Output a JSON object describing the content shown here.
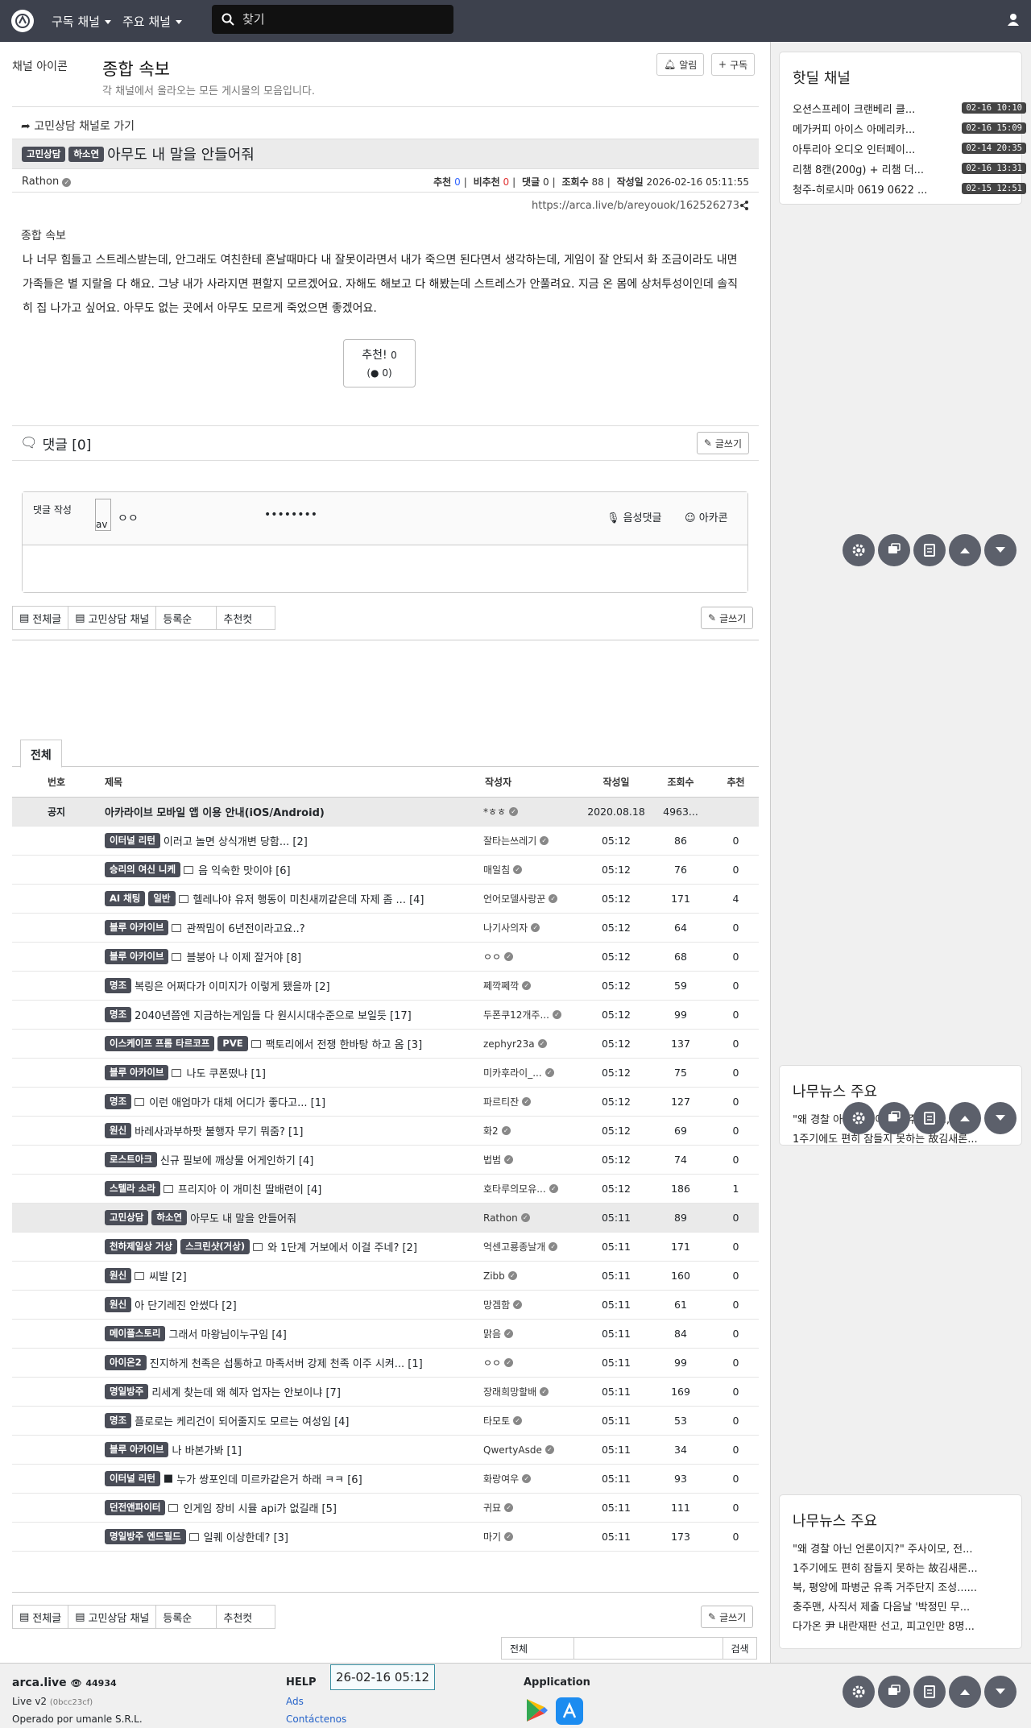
{
  "nav": {
    "menu1": "구독 채널",
    "menu2": "주요 채널",
    "search_placeholder": "찾기"
  },
  "board": {
    "logo_alt": "채널 아이콘",
    "title": "종합 속보",
    "desc": "각 채널에서 올라오는 모든 게시물의 모음입니다.",
    "alarm": "알림",
    "subscribe": "구독"
  },
  "article": {
    "goto": "고민상담 채널로 가기",
    "badge1": "고민상담",
    "badge2": "하소연",
    "title": "아무도 내 말을 안들어줘",
    "author": "Rathon",
    "label_up": "추천",
    "up": "0",
    "label_down": "비추천",
    "down": "0",
    "label_comments": "댓글",
    "comments": "0",
    "label_views": "조회수",
    "views": "88",
    "label_date": "작성일",
    "date": "2026-02-16 05:11:55",
    "url": "https://arca.live/b/areyouok/162526273",
    "img_alt": "종합 속보",
    "body": "나 너무 힘들고 스트레스받는데, 안그래도 여친한테 혼날때마다 내 잘못이라면서 내가 죽으면 된다면서 생각하는데, 게임이 잘 안되서 화 조금이라도 내면 가족들은 별 지랄을 다 해요. 그냥 내가 사라지면 편할지 모르겠어요. 자해도 해보고 다 해봤는데 스트레스가 안풀려요. 지금 온 몸에 상처투성이인데 솔직히 집 나가고 싶어요. 아무도 없는 곳에서 아무도 모르게 죽었으면 좋겠어요.",
    "vote_label": "추천!",
    "vote_count": "0",
    "vote_sub": "0"
  },
  "comments": {
    "header": "댓글 [0]",
    "write": "글쓰기",
    "form_label": "댓글 작성",
    "avatar_alt": "av",
    "nickname": "ㅇㅇ",
    "password": "••••••••",
    "voice": "음성댓글",
    "arcacon": "아카콘"
  },
  "tabs": {
    "all": "전체글",
    "channel": "고민상담 채널",
    "order": "등록순",
    "best": "추천컷",
    "write": "글쓰기"
  },
  "list": {
    "tab": "전체",
    "headers": {
      "num": "번호",
      "title": "제목",
      "author": "작성자",
      "date": "작성일",
      "views": "조회수",
      "rate": "추천"
    },
    "notice": {
      "num": "공지",
      "title": "아카라이브 모바일 앱 이용 안내(iOS/Android)",
      "author": "*ㅎㅎ",
      "date": "2020.08.18",
      "views": "4963...",
      "rate": ""
    },
    "rows": [
      {
        "badges": [
          "이터널 리턴"
        ],
        "file": false,
        "title": "이러고 놀면 상식개변 당함... [2]",
        "author": "잘타는쓰레기",
        "date": "05:12",
        "views": "86",
        "rate": "0"
      },
      {
        "badges": [
          "승리의 여신 니케"
        ],
        "file": true,
        "title": "음 익숙한 맛이야 [6]",
        "author": "매일침",
        "date": "05:12",
        "views": "76",
        "rate": "0"
      },
      {
        "badges": [
          "AI 채팅",
          "일반"
        ],
        "file": true,
        "title": "헬레나야 유저 행동이 미친새끼같은데 자제 좀 ... [4]",
        "author": "언어모델사랑꾼",
        "date": "05:12",
        "views": "171",
        "rate": "4"
      },
      {
        "badges": [
          "블루 아카이브"
        ],
        "file": true,
        "title": "관짝밈이 6년전이라고요..?",
        "author": "나기사의자",
        "date": "05:12",
        "views": "64",
        "rate": "0"
      },
      {
        "badges": [
          "블루 아카이브"
        ],
        "file": true,
        "title": "블붕아 나 이제 잘거야 [8]",
        "author": "ㅇㅇ",
        "date": "05:12",
        "views": "68",
        "rate": "0"
      },
      {
        "badges": [
          "명조"
        ],
        "file": false,
        "title": "복링은 어쩌다가 이미지가 이렇게 됐을까 [2]",
        "author": "쩨깍쩨깍",
        "date": "05:12",
        "views": "59",
        "rate": "0"
      },
      {
        "badges": [
          "명조"
        ],
        "file": false,
        "title": "2040년쯤엔 지금하는게임들 다 원시시대수준으로 보일듯 [17]",
        "author": "두폰쿠12개주...",
        "date": "05:12",
        "views": "99",
        "rate": "0"
      },
      {
        "badges": [
          "이스케이프 프롬 타르코프",
          "PVE"
        ],
        "file": true,
        "title": "팩토리에서 전쟁 한바탕 하고 옴 [3]",
        "author": "zephyr23a",
        "date": "05:12",
        "views": "137",
        "rate": "0"
      },
      {
        "badges": [
          "블루 아카이브"
        ],
        "file": true,
        "title": "나도 쿠폰떴냐 [1]",
        "author": "미카후라이_...",
        "date": "05:12",
        "views": "75",
        "rate": "0"
      },
      {
        "badges": [
          "명조"
        ],
        "file": true,
        "title": "이런 애엄마가 대체 어디가 좋다고... [1]",
        "author": "파르티잔",
        "date": "05:12",
        "views": "127",
        "rate": "0"
      },
      {
        "badges": [
          "원신"
        ],
        "file": false,
        "title": "바레사과부하팟 불행자 무기 뭐줌? [1]",
        "author": "화2",
        "date": "05:12",
        "views": "69",
        "rate": "0"
      },
      {
        "badges": [
          "로스트아크"
        ],
        "file": false,
        "title": "신규 필보에 깨상물 어게인하기 [4]",
        "author": "법범",
        "date": "05:12",
        "views": "74",
        "rate": "0"
      },
      {
        "badges": [
          "스텔라 소라"
        ],
        "file": true,
        "title": "프리지아 이 개미친 딸배련이 [4]",
        "author": "호타루의모유...",
        "date": "05:12",
        "views": "186",
        "rate": "1"
      },
      {
        "badges": [
          "고민상담",
          "하소연"
        ],
        "file": false,
        "title": "아무도 내 말을 안들어줘",
        "author": "Rathon",
        "date": "05:11",
        "views": "89",
        "rate": "0",
        "highlight": true
      },
      {
        "badges": [
          "천하제일상 거상",
          "스크린샷(거상)"
        ],
        "file": true,
        "title": "와 1단계 거보에서 이걸 주네? [2]",
        "author": "억센고룡종날개",
        "date": "05:11",
        "views": "171",
        "rate": "0"
      },
      {
        "badges": [
          "원신"
        ],
        "file": true,
        "title": "씨발 [2]",
        "author": "Zibb",
        "date": "05:11",
        "views": "160",
        "rate": "0"
      },
      {
        "badges": [
          "원신"
        ],
        "file": false,
        "title": "아 단기레진 안썼다 [2]",
        "author": "망겜함",
        "date": "05:11",
        "views": "61",
        "rate": "0"
      },
      {
        "badges": [
          "메이플스토리"
        ],
        "file": false,
        "title": "그래서 마왕님이누구임 [4]",
        "author": "맑음",
        "date": "05:11",
        "views": "84",
        "rate": "0"
      },
      {
        "badges": [
          "아이온2"
        ],
        "file": false,
        "title": "진지하게 천족은 섭통하고 마족서버 강제 천족 이주 시켜... [1]",
        "author": "ㅇㅇ",
        "date": "05:11",
        "views": "99",
        "rate": "0"
      },
      {
        "badges": [
          "명일방주"
        ],
        "file": false,
        "title": "리세계 찾는데 왜 혜자 업자는 안보이냐 [7]",
        "author": "장래희망할배",
        "date": "05:11",
        "views": "169",
        "rate": "0"
      },
      {
        "badges": [
          "명조"
        ],
        "file": false,
        "title": "플로로는 케리건이 되어줄지도 모르는 여성임 [4]",
        "author": "타모토",
        "date": "05:11",
        "views": "53",
        "rate": "0"
      },
      {
        "badges": [
          "블루 아카이브"
        ],
        "file": false,
        "title": "나 바본가봐 [1]",
        "author": "QwertyAsde",
        "date": "05:11",
        "views": "34",
        "rate": "0"
      },
      {
        "badges": [
          "이터널 리턴"
        ],
        "file": false,
        "video": true,
        "title": "누가 쌍포인데 미르카같은거 하래 ㅋㅋ [6]",
        "author": "화랑여우",
        "date": "05:11",
        "views": "93",
        "rate": "0"
      },
      {
        "badges": [
          "던전앤파이터"
        ],
        "file": true,
        "title": "인게임 장비 시뮬 api가 없길래 [5]",
        "author": "귀묘",
        "date": "05:11",
        "views": "111",
        "rate": "0"
      },
      {
        "badges": [
          "명일방주 엔드필드"
        ],
        "file": true,
        "title": "일퀘 이상한데? [3]",
        "author": "마기",
        "date": "05:11",
        "views": "173",
        "rate": "0"
      }
    ]
  },
  "bottom": {
    "search_select": "전체",
    "search_btn": "검색",
    "pager_current": "26-02-16 05:12"
  },
  "sidebar": {
    "hot_title": "핫딜 채널",
    "hot_items": [
      {
        "text": "오션스프레이 크랜베리 클...",
        "time": "02-16 10:10"
      },
      {
        "text": "메가커피 아이스 아메리카...",
        "time": "02-16 15:09"
      },
      {
        "text": "아투리아 오디오 인터페이...",
        "time": "02-14 20:35"
      },
      {
        "text": "리챔 8캔(200g) + 리챔 더...",
        "time": "02-16 13:31"
      },
      {
        "text": "청주-히로시마 0619 0622 ...",
        "time": "02-15 12:51"
      }
    ],
    "news_title_1": "나무뉴스 주요",
    "news_partial": [
      "\"왜 경찰 아닌 언론이지?\" 주사이모, 전...",
      "1주기에도 편히 잠들지 못하는 故김새론..."
    ],
    "news_title_2": "나무뉴스 주요",
    "news_items": [
      "\"왜 경찰 아닌 언론이지?\" 주사이모, 전...",
      "1주기에도 편히 잠들지 못하는 故김새론...",
      "북, 평양에 파병군 유족 거주단지 조성......",
      "충주맨, 사직서 제출 다음날 '박정민 무...",
      "다가온 尹 내란재판 선고, 피고인만 8명..."
    ]
  },
  "footer": {
    "brand": "arca.live",
    "users": "44934",
    "version": "Live v2",
    "hash": "(0bcc23cf)",
    "operator": "Operado por umanle S.R.L.",
    "help": "HELP",
    "ads": "Ads",
    "contact": "Contáctenos",
    "app": "Application"
  }
}
